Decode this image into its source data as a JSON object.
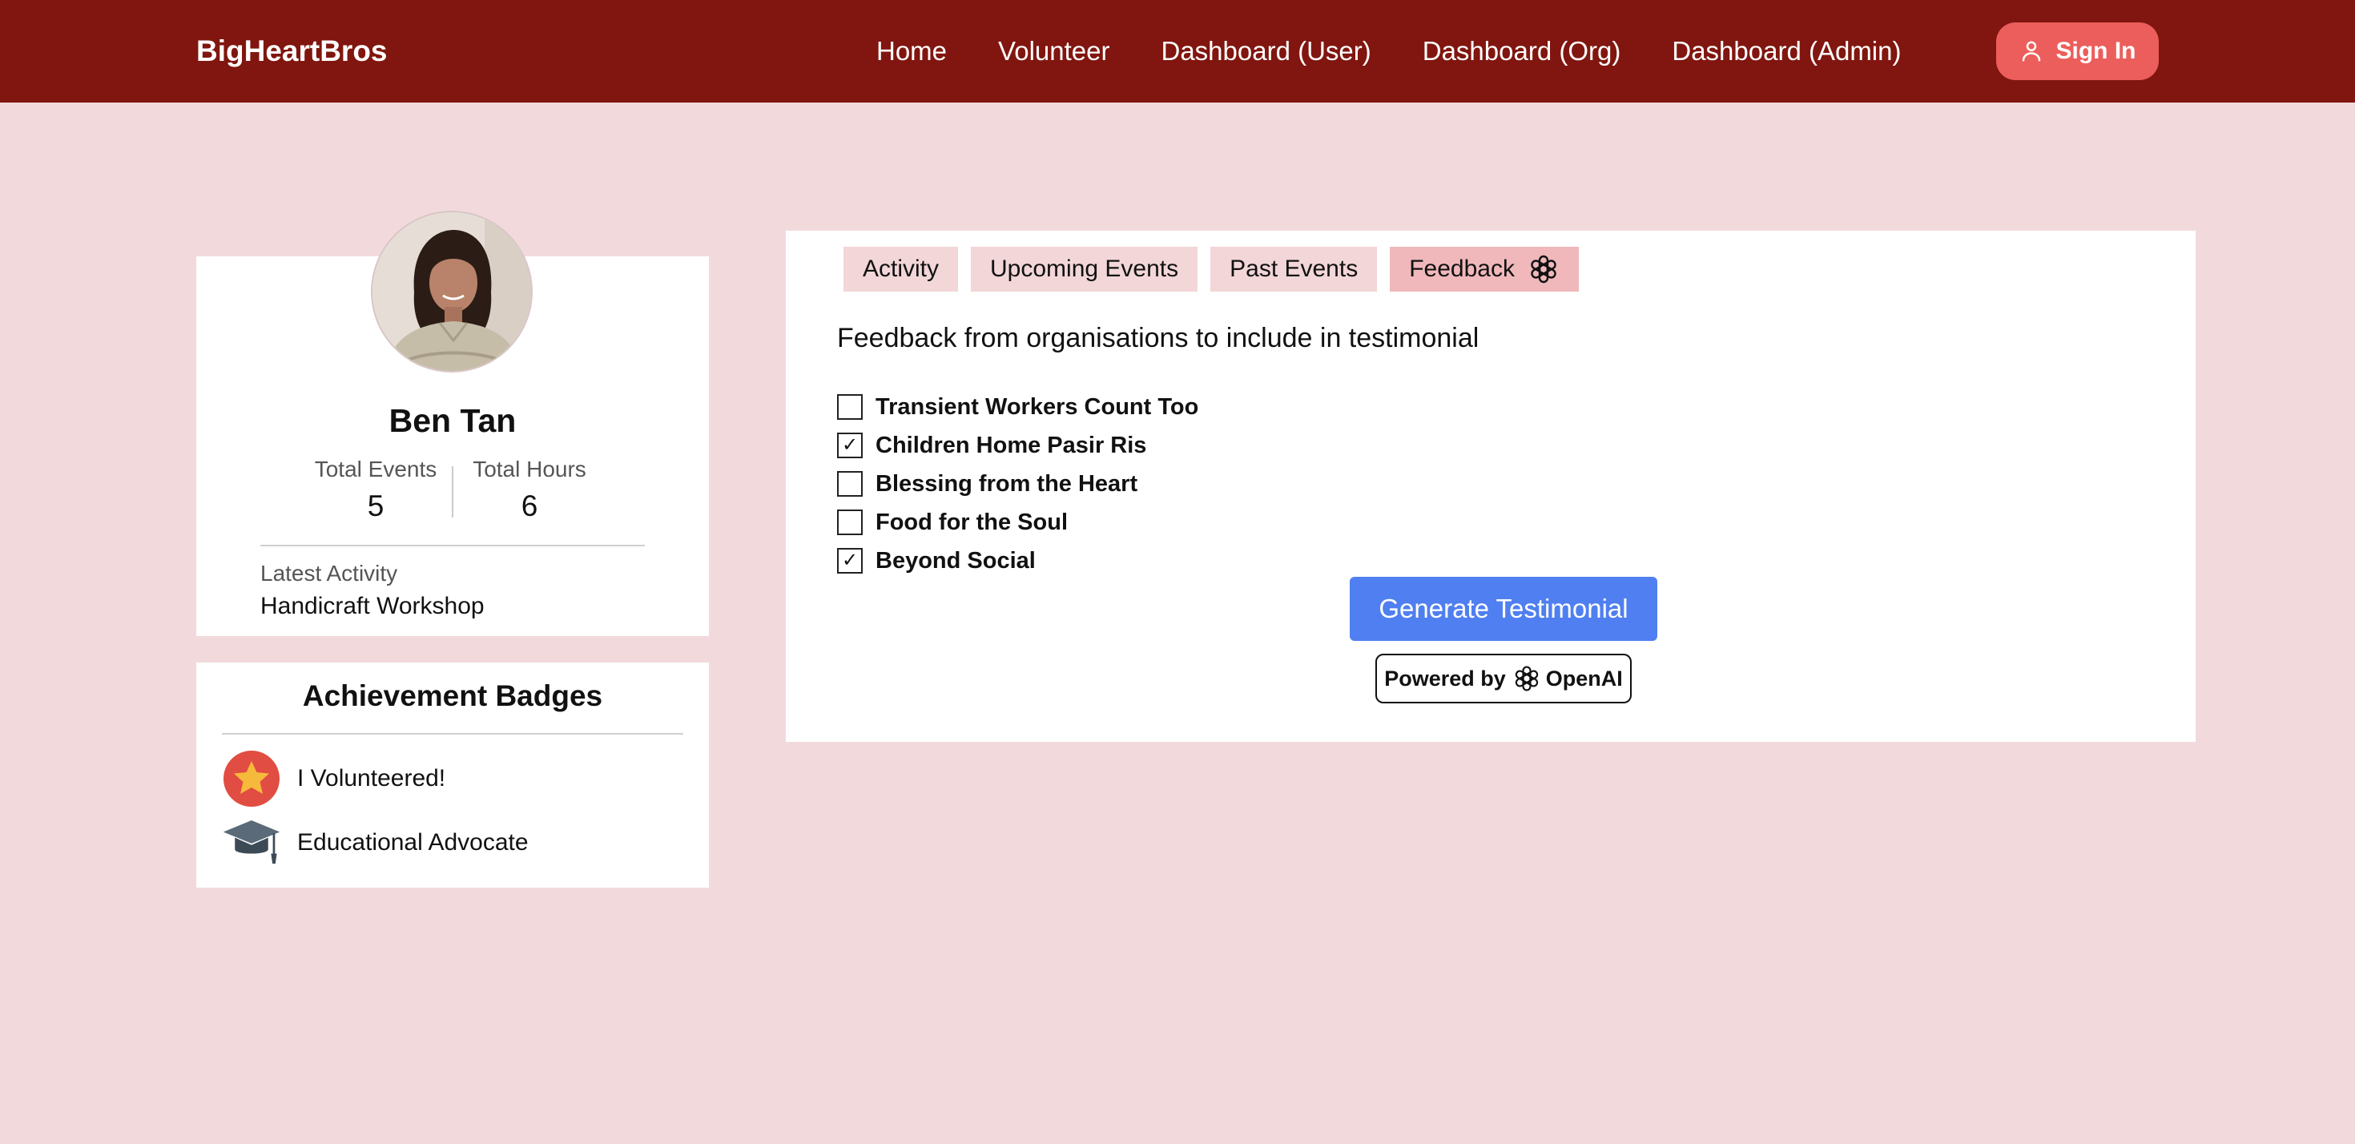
{
  "navbar": {
    "brand": "BigHeartBros",
    "links": [
      "Home",
      "Volunteer",
      "Dashboard (User)",
      "Dashboard (Org)",
      "Dashboard (Admin)"
    ],
    "signin_label": "Sign In",
    "background_color": "#80160f",
    "signin_color": "#ec5e5b"
  },
  "profile": {
    "name": "Ben Tan",
    "total_events_label": "Total Events",
    "total_events_value": "5",
    "total_hours_label": "Total Hours",
    "total_hours_value": "6",
    "latest_activity_label": "Latest Activity",
    "latest_activity_value": "Handicraft Workshop"
  },
  "badges": {
    "title": "Achievement Badges",
    "items": [
      {
        "label": "I Volunteered!",
        "icon": "star-badge-icon"
      },
      {
        "label": "Educational Advocate",
        "icon": "graduation-cap-icon"
      }
    ]
  },
  "tabs": [
    {
      "label": "Activity",
      "active": false
    },
    {
      "label": "Upcoming Events",
      "active": false
    },
    {
      "label": "Past Events",
      "active": false
    },
    {
      "label": "Feedback",
      "active": true,
      "icon": "openai-icon"
    }
  ],
  "feedback": {
    "heading": "Feedback from organisations to include in testimonial",
    "options": [
      {
        "label": "Transient Workers Count Too",
        "checked": false
      },
      {
        "label": "Children Home Pasir Ris",
        "checked": true
      },
      {
        "label": "Blessing from the Heart",
        "checked": false
      },
      {
        "label": "Food for the Soul",
        "checked": false
      },
      {
        "label": "Beyond Social",
        "checked": true
      }
    ],
    "generate_label": "Generate Testimonial",
    "generate_color": "#4f7ff0",
    "powered_by_prefix": "Powered by",
    "powered_by_brand": "OpenAI"
  },
  "colors": {
    "page_background": "#f2dadc",
    "tab_background": "#f2d6d8",
    "active_tab_background": "#f0b8bb"
  }
}
